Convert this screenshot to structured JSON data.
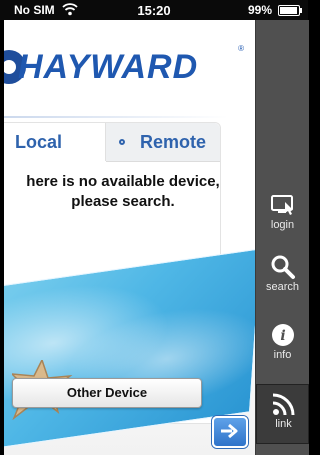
{
  "status_bar": {
    "carrier": "No SIM",
    "time": "15:20",
    "battery": "99%"
  },
  "brand": {
    "name": "HAYWARD",
    "registered": "®"
  },
  "tabs": [
    {
      "label": "Local",
      "selected": true
    },
    {
      "label": "Remote",
      "selected": false
    }
  ],
  "message": {
    "line1": "here is no available device,",
    "line2": "please search."
  },
  "buttons": {
    "other_device": "Other Device"
  },
  "sidebar": {
    "items": [
      {
        "label": "login",
        "icon": "login-icon"
      },
      {
        "label": "search",
        "icon": "search-icon"
      },
      {
        "label": "info",
        "icon": "info-icon"
      },
      {
        "label": "link",
        "icon": "wifi-link-icon",
        "active": true
      }
    ]
  },
  "colors": {
    "brand_blue": "#1f58b0",
    "tab_text": "#2f63ad",
    "sidebar_bg": "#505050"
  }
}
